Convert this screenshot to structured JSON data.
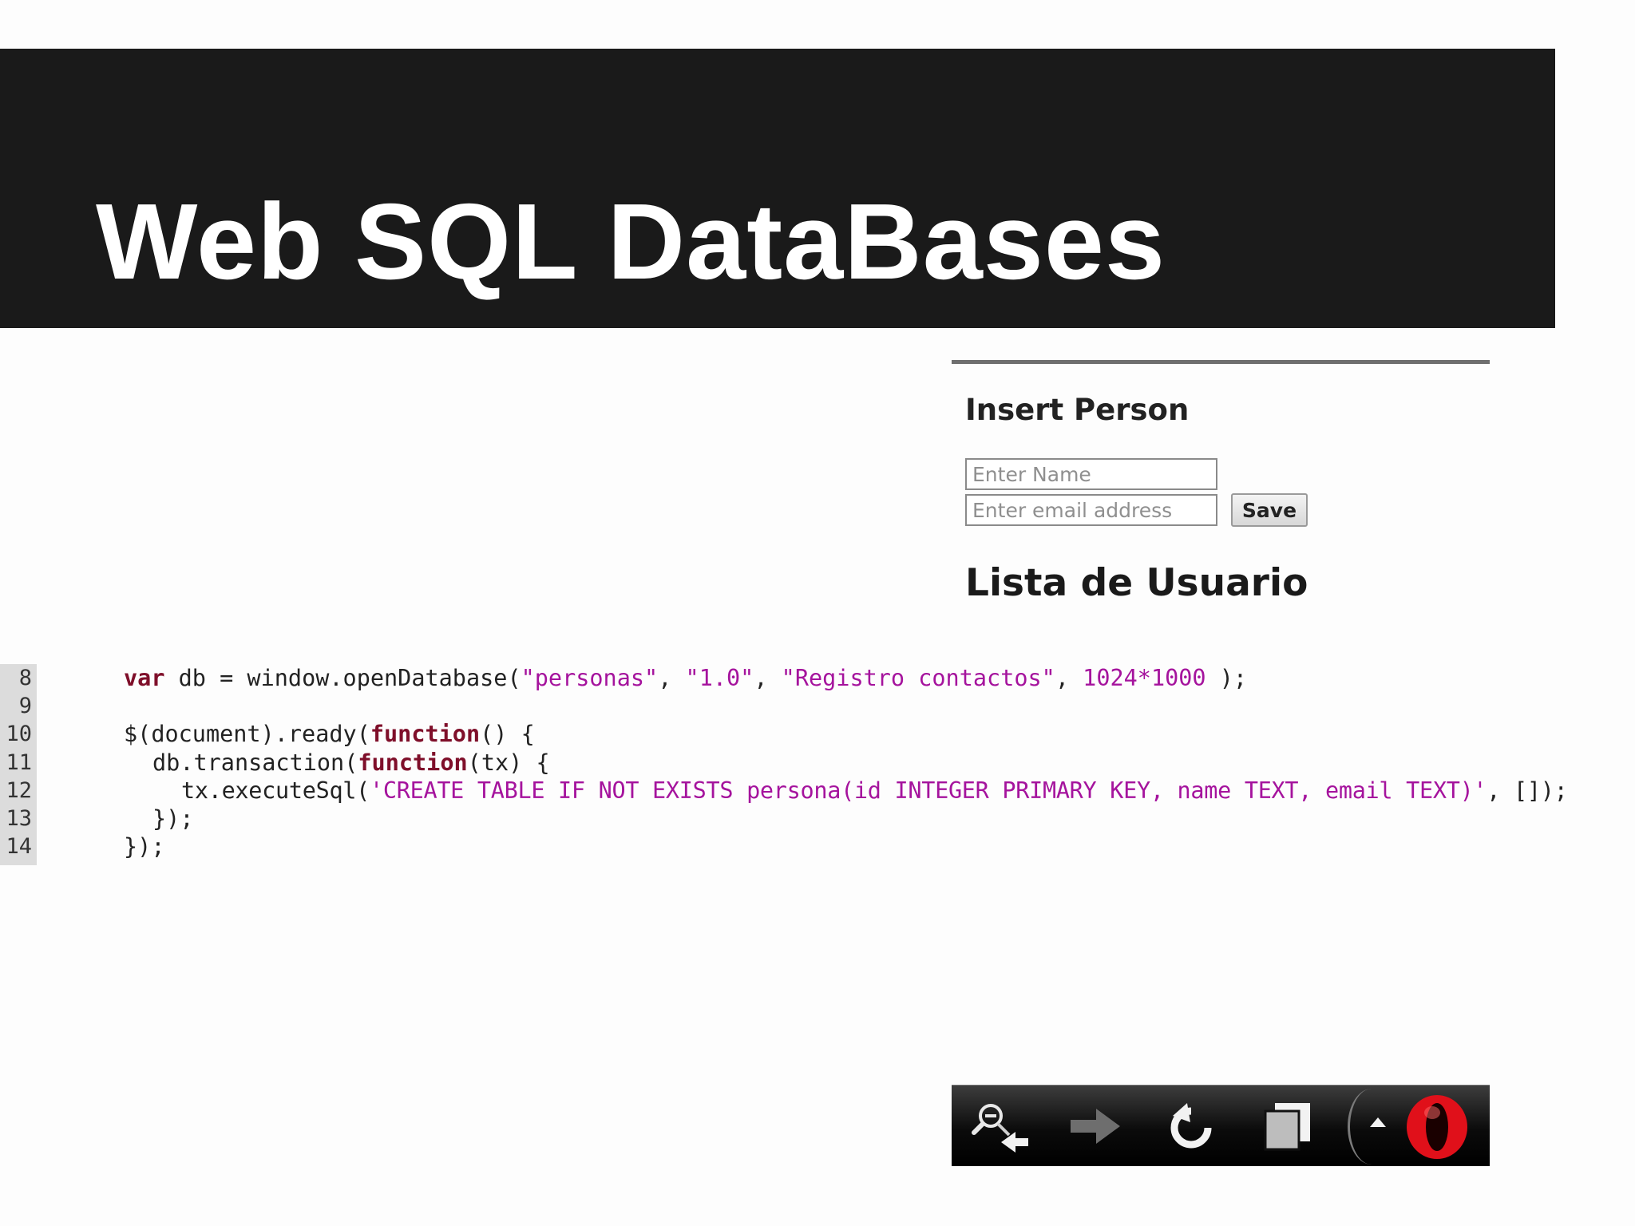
{
  "slide": {
    "title": "Web SQL DataBases"
  },
  "browser": {
    "insert_heading": "Insert Person",
    "name_placeholder": "Enter Name",
    "email_placeholder": "Enter email address",
    "save_label": "Save",
    "list_heading": "Lista de Usuario"
  },
  "code": {
    "line_numbers": [
      "8",
      "9",
      "10",
      "11",
      "12",
      "13",
      "14"
    ],
    "line8": {
      "kw_var": "var",
      "decl": " db = window.openDatabase(",
      "s1": "\"personas\"",
      "c1": ", ",
      "s2": "\"1.0\"",
      "c2": ", ",
      "s3": "\"Registro contactos\"",
      "c3": ", ",
      "size": "1024*1000",
      "end": " );"
    },
    "line10": {
      "pre": "$(document).ready(",
      "kw": "function",
      "post": "() {"
    },
    "line11": {
      "pre": "db.transaction(",
      "kw": "function",
      "post": "(tx) {"
    },
    "line12": {
      "pre": "tx.executeSql(",
      "sql": "'CREATE TABLE IF NOT EXISTS persona(id INTEGER PRIMARY KEY, name TEXT, email TEXT)'",
      "post": ", []);"
    },
    "line13": "});",
    "line14": "});"
  },
  "toolbar": {
    "icons": [
      "zoom-back-icon",
      "forward-arrow-icon",
      "reload-icon",
      "tabs-icon",
      "menu-up-icon",
      "opera-logo-icon"
    ],
    "opera_red": "#e0101a"
  },
  "colors": {
    "banner": "#1a1a1a",
    "keyword": "#7f0f2a",
    "string": "#a5139d"
  }
}
